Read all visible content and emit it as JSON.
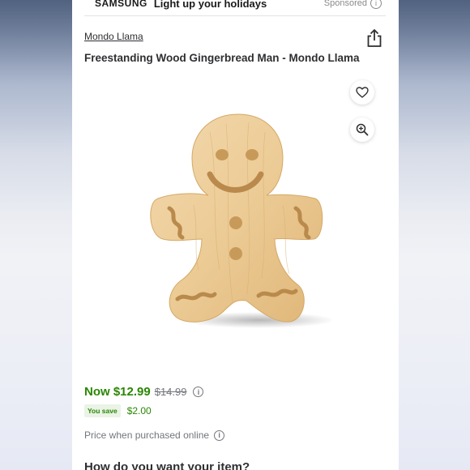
{
  "banner": {
    "brand": "SAMSUNG",
    "text": "Light up your holidays",
    "sponsored": "Sponsored",
    "info_icon": "info-icon"
  },
  "product": {
    "brand_link": "Mondo Llama",
    "title": "Freestanding Wood Gingerbread Man - Mondo Llama",
    "image_icon": "gingerbread-man-image"
  },
  "actions": {
    "share_icon": "share-icon",
    "favorite_icon": "heart-icon",
    "zoom_icon": "zoom-in-icon"
  },
  "pricing": {
    "now_price": "Now $12.99",
    "was_price": "$14.99",
    "you_save_label": "You save",
    "save_amount": "$2.00",
    "online_note": "Price when purchased online"
  },
  "section": {
    "heading": "How do you want your item?"
  },
  "colors": {
    "price_green": "#2a8703",
    "text_dark": "#2e2f32",
    "muted": "#74767c"
  }
}
